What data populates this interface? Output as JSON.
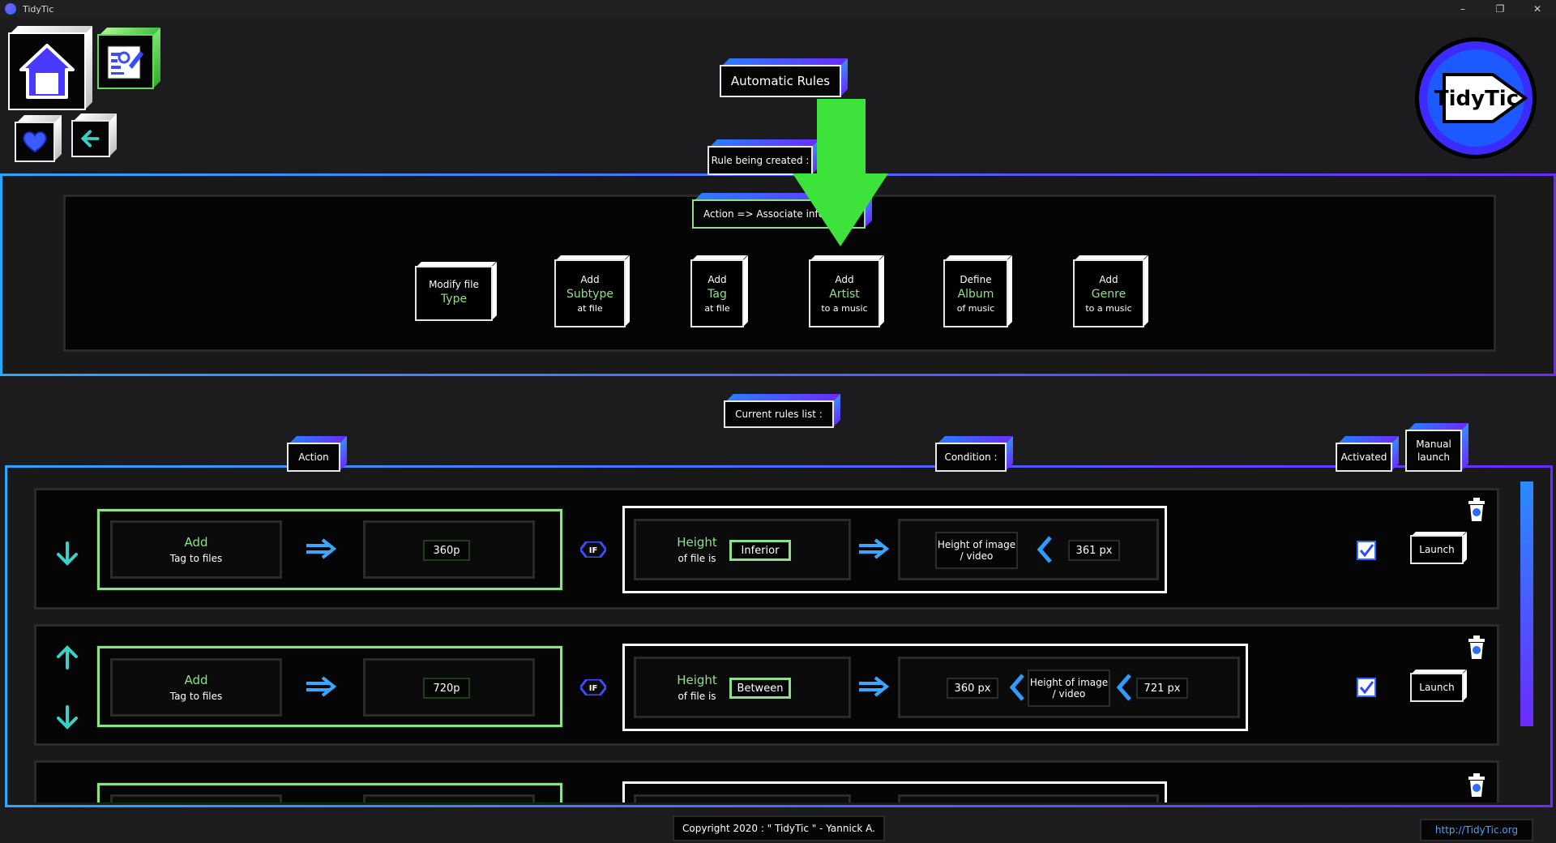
{
  "window": {
    "title": "TidyTic",
    "minimize": "–",
    "maximize": "❐",
    "close": "✕"
  },
  "header": {
    "page_title": "Automatic Rules"
  },
  "logo": {
    "text": "TidyTic"
  },
  "creation": {
    "heading": "Rule being created :",
    "action_label": "Action => Associate inform",
    "buttons": [
      {
        "l1": "Modify file",
        "l2": "Type",
        "l3": ""
      },
      {
        "l1": "Add",
        "l2": "Subtype",
        "l3": "at file"
      },
      {
        "l1": "Add",
        "l2": "Tag",
        "l3": "at file"
      },
      {
        "l1": "Add",
        "l2": "Artist",
        "l3": "to a music"
      },
      {
        "l1": "Define",
        "l2": "Album",
        "l3": "of music"
      },
      {
        "l1": "Add",
        "l2": "Genre",
        "l3": "to a music"
      }
    ]
  },
  "rules": {
    "heading": "Current rules list :",
    "col_action": "Action",
    "col_condition": "Condition :",
    "col_activated": "Activated",
    "col_manual": "Manual launch",
    "rows": [
      {
        "action_title": "Add",
        "action_sub": "Tag to files",
        "value": "360p",
        "cond_title": "Height",
        "cond_sub": "of file is",
        "operator": "Inferior",
        "target": "Height of image / video",
        "limit": "361 px",
        "launch": "Launch"
      },
      {
        "action_title": "Add",
        "action_sub": "Tag to files",
        "value": "720p",
        "cond_title": "Height",
        "cond_sub": "of file is",
        "operator": "Between",
        "low": "360 px",
        "target": "Height of image / video",
        "limit": "721 px",
        "launch": "Launch"
      }
    ]
  },
  "footer": {
    "copyright": "Copyright 2020 : \" TidyTic \" - Yannick A.",
    "website": "http://TidyTic.org"
  },
  "colors": {
    "accent_blue": "#2a8bff",
    "accent_purple": "#6a2bff",
    "accent_green": "#8fe08a",
    "arrow_green": "#3de33a"
  }
}
